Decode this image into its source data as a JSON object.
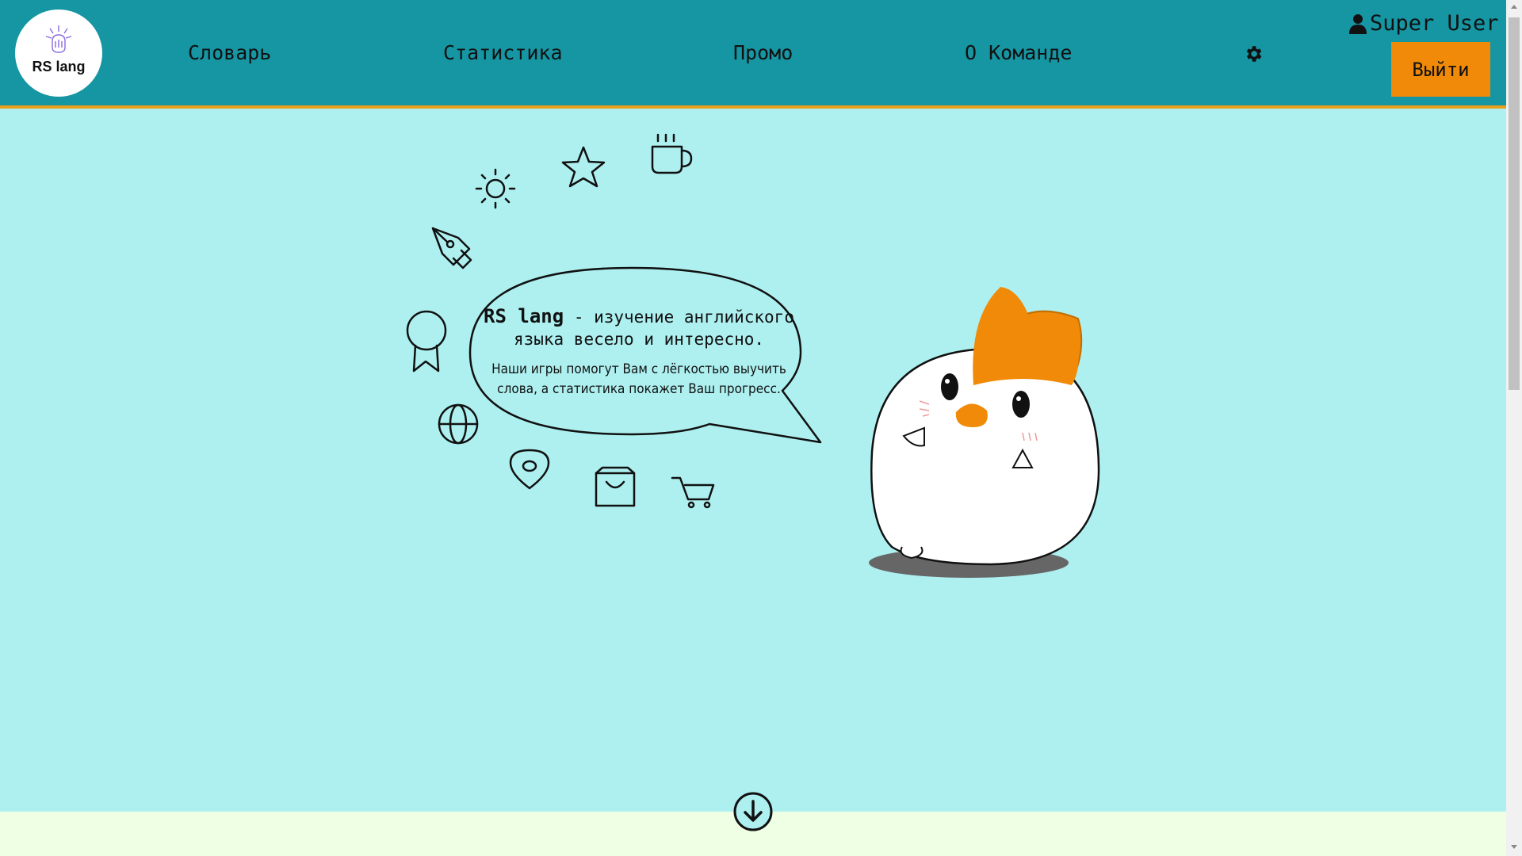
{
  "header": {
    "logo_text": "RS lang",
    "nav": [
      "Словарь",
      "Статистика",
      "Промо",
      "О Команде"
    ],
    "user_name": "Super User",
    "logout_label": "Выйти"
  },
  "hero": {
    "brand": "RS lang",
    "tagline_rest": " - изучение английского языка весело и интересно.",
    "description": "Наши игры помогут Вам с лёгкостью выучить слова, а статистика покажет Ваш прогресс."
  },
  "colors": {
    "header_bg": "#1695a3",
    "accent": "#f08a08",
    "hero_bg": "#aef0f0",
    "footer_bg": "#efffe4"
  },
  "icons": [
    "user-icon",
    "gear-icon",
    "sun-icon",
    "star-icon",
    "cup-icon",
    "pen-icon",
    "award-icon",
    "globe-icon",
    "location-icon",
    "bag-icon",
    "cart-icon",
    "arrow-down-circle-icon"
  ]
}
